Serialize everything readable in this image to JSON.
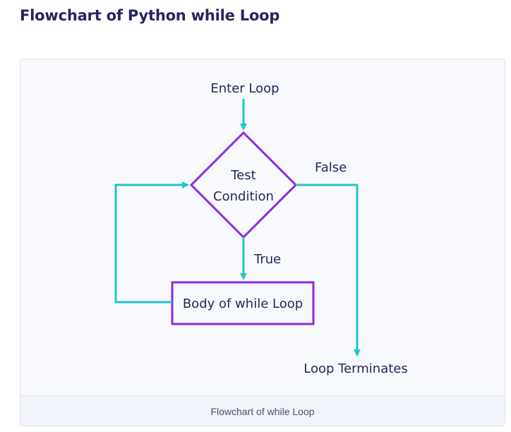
{
  "page": {
    "title": "Flowchart of Python while Loop"
  },
  "diagram": {
    "start_label": "Enter Loop",
    "decision_line1": "Test",
    "decision_line2": "Condition",
    "false_label": "False",
    "true_label": "True",
    "body_label": "Body of while Loop",
    "end_label": "Loop Terminates",
    "colors": {
      "arrow": "#1ec5cf",
      "shape_border": "#8a2be2",
      "text": "#25265e",
      "background": "#f8f9fc"
    }
  },
  "figure": {
    "caption": "Flowchart of while Loop"
  }
}
